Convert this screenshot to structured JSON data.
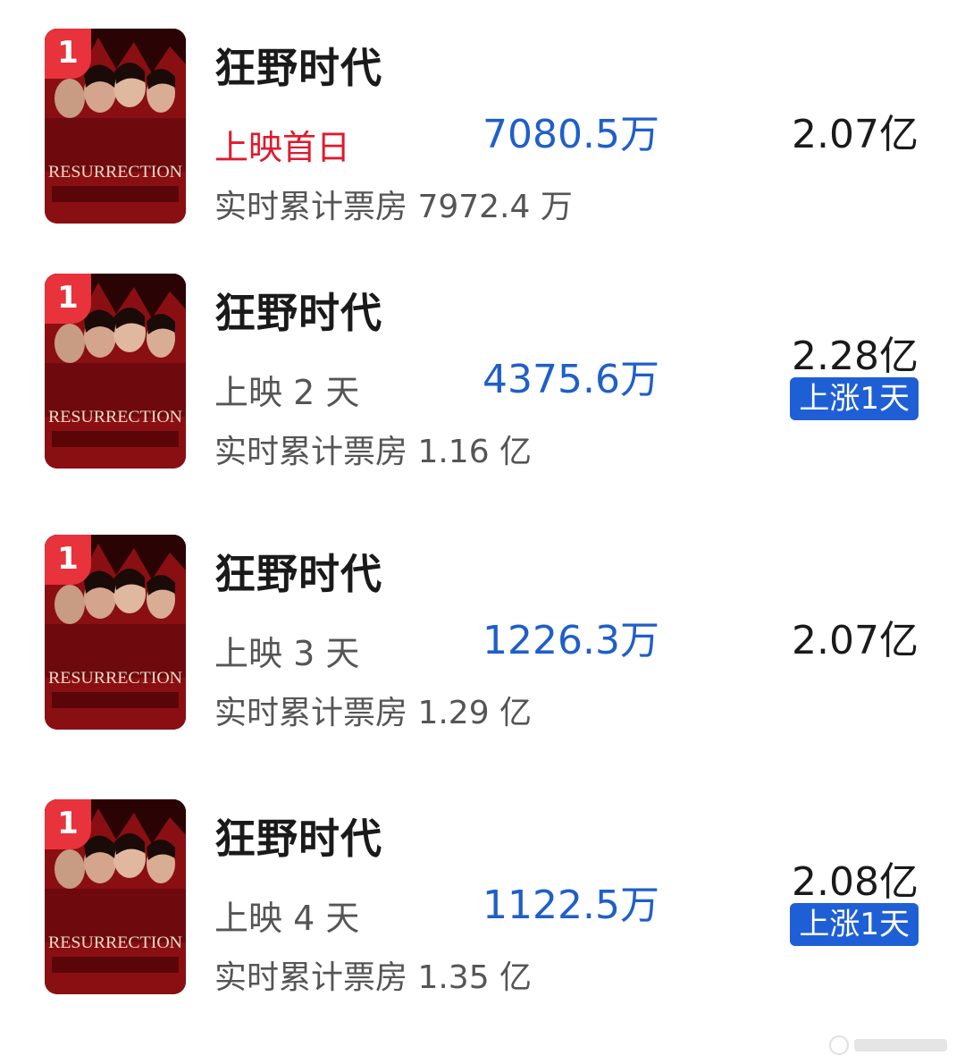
{
  "rows": [
    {
      "rank": "1",
      "title": "狂野时代",
      "status": "上映首日",
      "cumulative": "实时累计票房 7972.4 万",
      "daily_box_office": "7080.5万",
      "prediction": "2.07亿",
      "tag": ""
    },
    {
      "rank": "1",
      "title": "狂野时代",
      "status": "上映 2 天",
      "cumulative": "实时累计票房 1.16 亿",
      "daily_box_office": "4375.6万",
      "prediction": "2.28亿",
      "tag": "上涨1天"
    },
    {
      "rank": "1",
      "title": "狂野时代",
      "status": "上映 3 天",
      "cumulative": "实时累计票房 1.29 亿",
      "daily_box_office": "1226.3万",
      "prediction": "2.07亿",
      "tag": ""
    },
    {
      "rank": "1",
      "title": "狂野时代",
      "status": "上映 4 天",
      "cumulative": "实时累计票房 1.35 亿",
      "daily_box_office": "1122.5万",
      "prediction": "2.08亿",
      "tag": "上涨1天"
    }
  ],
  "poster_text": "RESURRECTION",
  "colors": {
    "accent_blue": "#1f5fc8",
    "status_red": "#e0192c",
    "badge_red": "#e8323c",
    "tag_blue": "#1f5fd6"
  }
}
